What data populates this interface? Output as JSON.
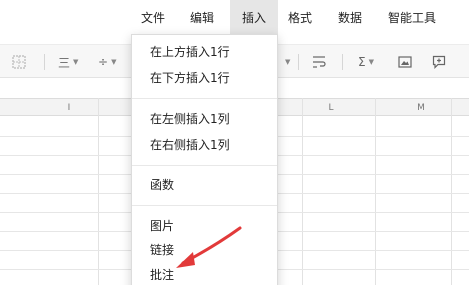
{
  "menubar": {
    "items": [
      {
        "label": "文件"
      },
      {
        "label": "编辑"
      },
      {
        "label": "插入"
      },
      {
        "label": "格式"
      },
      {
        "label": "数据"
      },
      {
        "label": "智能工具"
      }
    ]
  },
  "toolbar": {
    "align_symbol": "三",
    "divide_symbol": "÷",
    "sum_symbol": "Σ"
  },
  "sheet": {
    "columns": [
      "I",
      "L",
      "M"
    ]
  },
  "insert_menu": {
    "items": [
      {
        "label": "在上方插入1行"
      },
      {
        "label": "在下方插入1行"
      },
      {
        "label": "在左侧插入1列"
      },
      {
        "label": "在右侧插入1列"
      },
      {
        "label": "函数"
      },
      {
        "label": "图片"
      },
      {
        "label": "链接"
      },
      {
        "label": "批注"
      }
    ]
  },
  "colors": {
    "annotation_arrow": "#e23a3a",
    "active_menu_bg": "#e6e6e6"
  }
}
